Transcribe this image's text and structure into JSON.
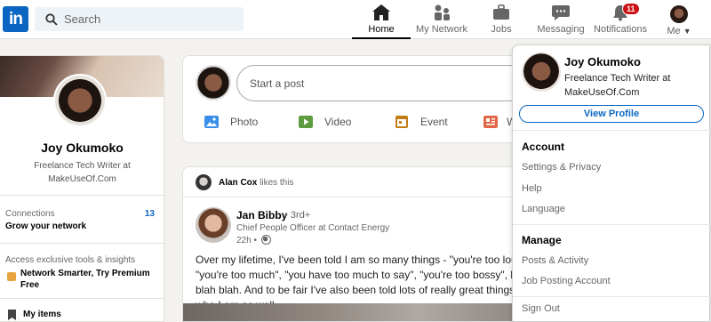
{
  "nav": {
    "logo": "in",
    "search_placeholder": "Search",
    "items": [
      {
        "label": "Home",
        "icon": "home-icon"
      },
      {
        "label": "My Network",
        "icon": "network-icon"
      },
      {
        "label": "Jobs",
        "icon": "briefcase-icon"
      },
      {
        "label": "Messaging",
        "icon": "message-icon"
      },
      {
        "label": "Notifications",
        "icon": "bell-icon",
        "badge": "11"
      },
      {
        "label": "Me",
        "icon": "avatar"
      }
    ]
  },
  "profile_card": {
    "name": "Joy Okumoko",
    "title": "Freelance Tech Writer at MakeUseOf.Com",
    "connections_label": "Connections",
    "connections_count": "13",
    "grow_network": "Grow your network",
    "premium_note": "Access exclusive tools & insights",
    "premium_link": "Network Smarter, Try Premium Free",
    "my_items": "My items"
  },
  "share_box": {
    "placeholder": "Start a post",
    "actions": [
      {
        "label": "Photo",
        "color": "#378fe9"
      },
      {
        "label": "Video",
        "color": "#5f9b41"
      },
      {
        "label": "Event",
        "color": "#c37d16"
      },
      {
        "label": "W",
        "color": "#e06847"
      }
    ]
  },
  "post": {
    "liker": "Alan Cox",
    "liker_action": "likes this",
    "author": "Jan Bibby",
    "degree": "• 3rd+",
    "role": "Chief People Officer at Contact Energy",
    "time": "22h •",
    "body": "Over my lifetime, I've been told I am so many things - \"you're too loud\", \"you're too much\", \"you have too much to say\", \"you're too bossy\", blah blah blah. And to be fair I've also been told lots of really great things about who I am as well."
  },
  "dropdown": {
    "name": "Joy Okumoko",
    "title": "Freelance Tech Writer at MakeUseOf.Com",
    "view_profile": "View Profile",
    "account_head": "Account",
    "account_items": [
      "Settings & Privacy",
      "Help",
      "Language"
    ],
    "manage_head": "Manage",
    "manage_items": [
      "Posts & Activity",
      "Job Posting Account"
    ],
    "sign_out": "Sign Out"
  },
  "colors": {
    "brand": "#0a66c2",
    "badge": "#cc1016"
  }
}
